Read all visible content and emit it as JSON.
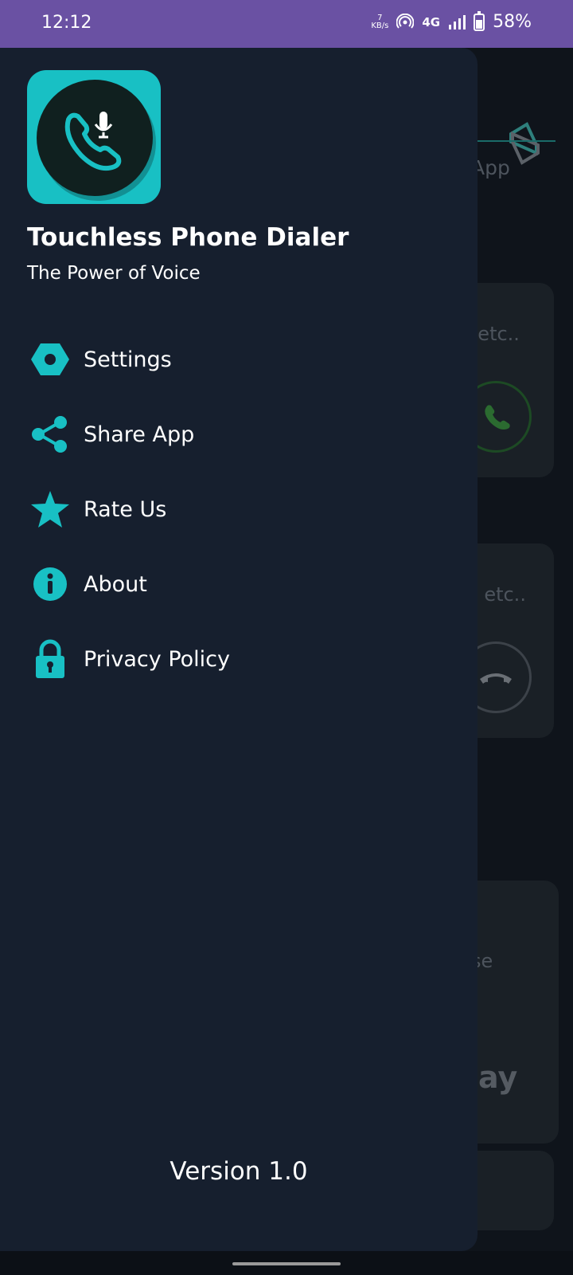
{
  "status_bar": {
    "time": "12:12",
    "net_speed_value": "7",
    "net_speed_unit": "KB/s",
    "network": "4G",
    "battery": "58%"
  },
  "background": {
    "tab_text": "App",
    "card1_text": "l etc..",
    "card2_text": "o etc..",
    "card3_text": "se",
    "card3_big": "lay"
  },
  "drawer": {
    "app_name": "Touchless Phone Dialer",
    "tagline": "The Power of Voice",
    "menu": [
      {
        "label": "Settings",
        "icon": "settings-icon"
      },
      {
        "label": "Share App",
        "icon": "share-icon"
      },
      {
        "label": "Rate Us",
        "icon": "star-icon"
      },
      {
        "label": "About",
        "icon": "info-icon"
      },
      {
        "label": "Privacy Policy",
        "icon": "lock-icon"
      }
    ],
    "version": "Version 1.0"
  },
  "colors": {
    "accent": "#18c0c4",
    "drawer_bg": "#161f2e",
    "status_bar": "#6a51a3"
  }
}
